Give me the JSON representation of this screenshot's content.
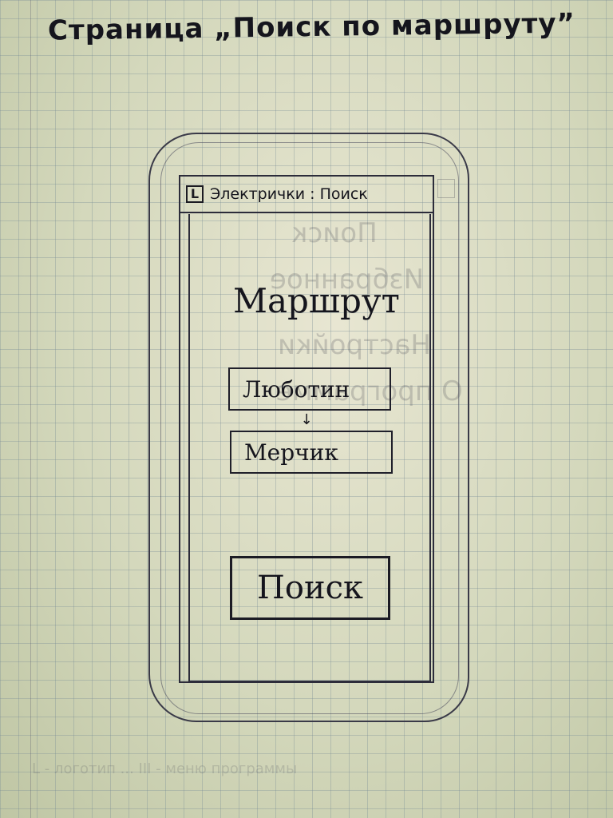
{
  "page": {
    "title": "Страница „Поиск по маршруту”"
  },
  "app_header": {
    "logo": "L",
    "title": "Электрички : Поиск"
  },
  "ghost_menu": {
    "items": [
      "Поиск",
      "Избранное",
      "Настройки",
      "О программе"
    ]
  },
  "main": {
    "heading": "Маршрут",
    "from_value": "Люботин",
    "to_value": "Мерчик",
    "arrow": "↓",
    "search_label": "Поиск"
  },
  "faint_note": "L - логотип     ...     III - меню программы",
  "icons": {
    "app_logo": "logo-icon",
    "arrow": "arrow-down-icon",
    "menu": "menu-icon"
  }
}
